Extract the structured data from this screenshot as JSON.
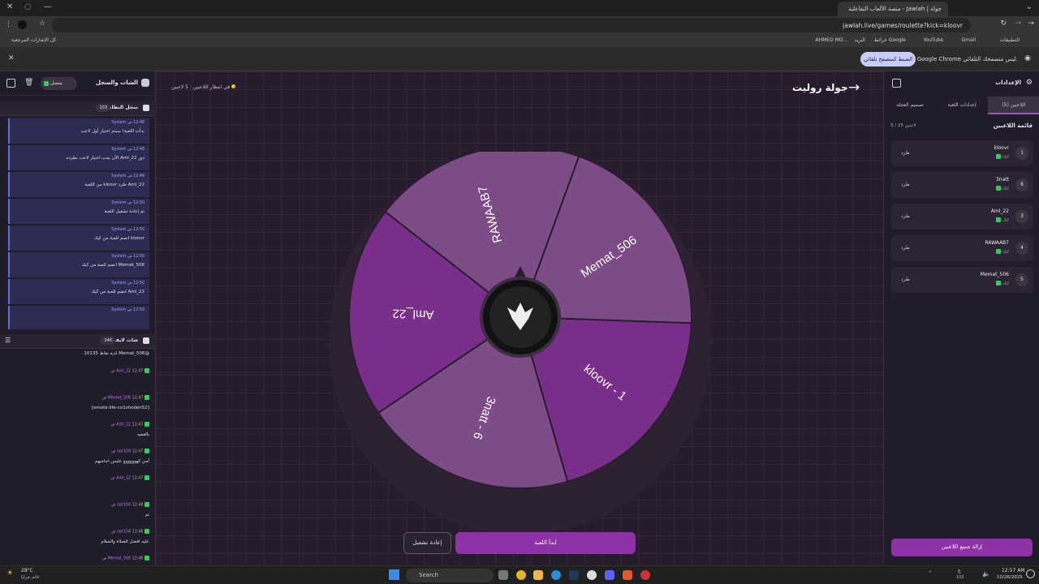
{
  "browser": {
    "tab_title": "جولة | Jawlah - منصة الألعاب التفاعلية",
    "url": "jawlah.live/games/roulette?kick=kloovr",
    "bookmarks": [
      "التطبيقات",
      "Gmail",
      "YouTube",
      "خرائط Google",
      "البريد",
      "AHMED MO...",
      "كل الإشارات المرجعية"
    ],
    "infobar_text": "Google Chrome ليس متصفحك التلقائي.",
    "infobar_button": "الضبط كمتصفح تلقائي"
  },
  "left_panel": {
    "title": "الشات والسجل",
    "status": "متصل",
    "system_log": {
      "title": "سجل النظام",
      "count": "103",
      "items": [
        {
          "meta": "12:48 ص System",
          "text": "بدأت اللعبة! سيتم اختيار أول لاعب"
        },
        {
          "meta": "12:48 ص System",
          "text": "دور Aml_22 الآن يجب اختيار لاعب بطرده"
        },
        {
          "meta": "12:49 ص System",
          "text": "Aml_22 طرد kloovr من اللعبة"
        },
        {
          "meta": "12:50 ص System",
          "text": "تم إعادة تشغيل اللعبة"
        },
        {
          "meta": "12:50 ص System",
          "text": "kloovr انضم للعبة من كيك"
        },
        {
          "meta": "12:50 ص System",
          "text": "Memat_506 انضم للعبة من كيك"
        },
        {
          "meta": "12:50 ص System",
          "text": "Aml_22 انضم للعبة من كيك"
        },
        {
          "meta": "12:50 ص System",
          "text": ""
        }
      ]
    },
    "live_chat": {
      "title": "شات لايف",
      "count": "246",
      "pinned": "@Memat_506 لديه نقاط 10135.",
      "messages": [
        {
          "user": "Aml_22",
          "time": "12:47 ص",
          "text": ""
        },
        {
          "user": "Memat_506",
          "time": "12:47 ص",
          "text": "[emote:life-co1shoden52]"
        },
        {
          "user": "Aml_22",
          "time": "12:47 ص",
          "text": "بالقفيه"
        },
        {
          "user": "nar104",
          "time": "12:47 ص",
          "text": "أمي كهوووووو عليس اجاحيهم"
        },
        {
          "user": "Aml_22",
          "time": "12:47 ص",
          "text": ""
        },
        {
          "user": "nar104",
          "time": "12:48 ص",
          "text": "تم"
        },
        {
          "user": "nar104",
          "time": "12:48 ص",
          "text": "عليه افضل الصلاة والسلام"
        },
        {
          "user": "Memat_506",
          "time": "12:48 ص",
          "text": ""
        }
      ]
    }
  },
  "main": {
    "title": "جولة روليت",
    "players_count": "5 لاعبين",
    "waiting": "في انتظار اللاعبين",
    "start_button": "ابدأ اللعبة",
    "restart_button": "إعادة تشغيل"
  },
  "wheel": {
    "segments": [
      "Memat_506",
      "kloovr - 1",
      "3natt - 6",
      "Aml_22",
      "RAWAAB7"
    ],
    "colors": [
      "#7d4b85",
      "#772f8a"
    ]
  },
  "right_panel": {
    "title": "الإعدادات",
    "tabs": [
      "اللاعبين (5)",
      "إعدادات اللعبة",
      "تصميم العجلة"
    ],
    "list_title": "قائمة اللاعبين",
    "list_count": "5 / 25 لاعبين",
    "kick_label": "طرد",
    "players": [
      {
        "num": "1",
        "name": "kloovr",
        "source": "كيك"
      },
      {
        "num": "6",
        "name": "3natt",
        "source": "كيك"
      },
      {
        "num": "3",
        "name": "Aml_22",
        "source": "كيك"
      },
      {
        "num": "4",
        "name": "RAWAAB7",
        "source": "كيك"
      },
      {
        "num": "5",
        "name": "Memat_506",
        "source": "كيك"
      }
    ],
    "remove_all": "إزالة جميع اللاعبين"
  },
  "taskbar": {
    "weather_temp": "28°C",
    "weather_desc": "غائم جزئيًا",
    "search": "Search",
    "time": "12:57 AM",
    "date": "10/26/2025",
    "lang": "ع",
    "lang_sub": "102"
  }
}
